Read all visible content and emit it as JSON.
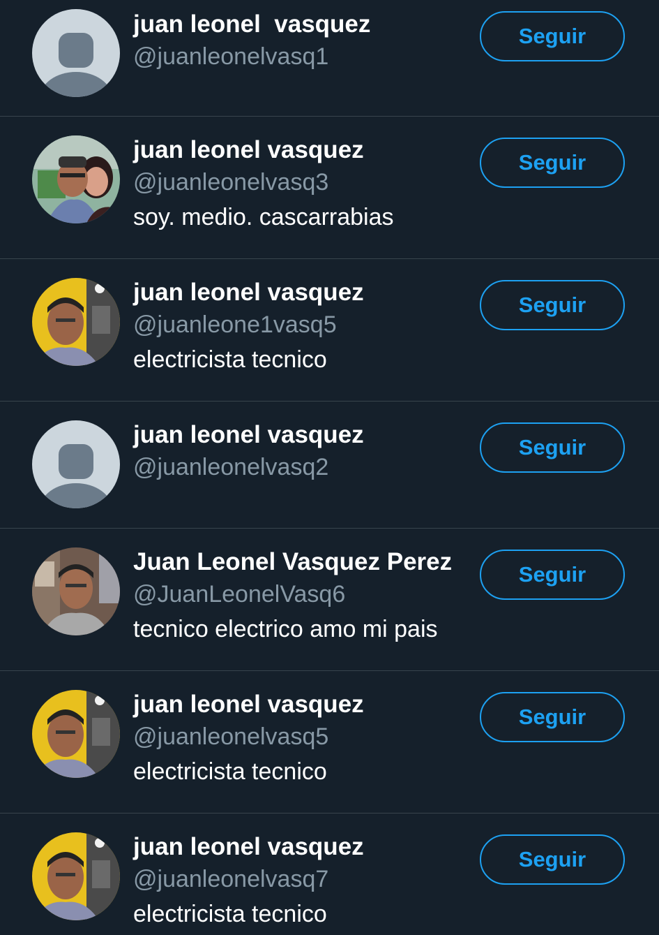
{
  "colors": {
    "background": "#15202b",
    "divider": "#38444d",
    "accent": "#1da1f2",
    "secondary_text": "#8899a6",
    "primary_text": "#ffffff"
  },
  "follow_label": "Seguir",
  "users": [
    {
      "name": "juan leonel  vasquez",
      "handle": "@juanleonelvasq1",
      "bio": "",
      "avatar": "default-profile-icon"
    },
    {
      "name": "juan leonel vasquez",
      "handle": "@juanleonelvasq3",
      "bio": "soy. medio. cascarrabias",
      "avatar": "couple-photo"
    },
    {
      "name": "juan leonel vasquez",
      "handle": "@juanleone1vasq5",
      "bio": "electricista tecnico",
      "avatar": "man-yellow-background-photo"
    },
    {
      "name": "juan leonel vasquez",
      "handle": "@juanleonelvasq2",
      "bio": "",
      "avatar": "default-profile-icon"
    },
    {
      "name": "Juan Leonel Vasquez Perez",
      "handle": "@JuanLeonelVasq6",
      "bio": "tecnico electrico amo mi pais",
      "avatar": "man-office-photo"
    },
    {
      "name": "juan leonel vasquez",
      "handle": "@juanleonelvasq5",
      "bio": "electricista tecnico",
      "avatar": "man-yellow-background-photo"
    },
    {
      "name": "juan leonel vasquez",
      "handle": "@juanleonelvasq7",
      "bio": "electricista tecnico",
      "avatar": "man-yellow-background-photo"
    }
  ]
}
